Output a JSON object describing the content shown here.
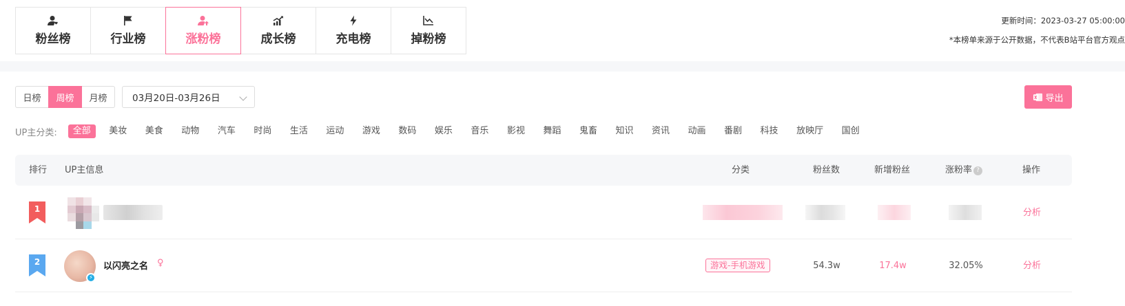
{
  "top_tabs": [
    {
      "label": "粉丝榜",
      "icon": "user-heart-icon"
    },
    {
      "label": "行业榜",
      "icon": "flag-icon"
    },
    {
      "label": "涨粉榜",
      "icon": "user-up-icon",
      "active": true
    },
    {
      "label": "成长榜",
      "icon": "growth-chart-icon"
    },
    {
      "label": "充电榜",
      "icon": "lightning-icon"
    },
    {
      "label": "掉粉榜",
      "icon": "line-chart-down-icon"
    }
  ],
  "header": {
    "update_time": "更新时间：2023-03-27 05:00:00",
    "disclaimer": "*本榜单来源于公开数据，不代表B站平台官方观点"
  },
  "filters": {
    "periods": [
      "日榜",
      "周榜",
      "月榜"
    ],
    "active_period": "周榜",
    "date_range": "03月20日-03月26日",
    "export_label": "导出"
  },
  "categories": {
    "label": "UP主分类:",
    "items": [
      "全部",
      "美妆",
      "美食",
      "动物",
      "汽车",
      "时尚",
      "生活",
      "运动",
      "游戏",
      "数码",
      "娱乐",
      "音乐",
      "影视",
      "舞蹈",
      "鬼畜",
      "知识",
      "资讯",
      "动画",
      "番剧",
      "科技",
      "放映厅",
      "国创"
    ],
    "active": "全部"
  },
  "table": {
    "headers": {
      "rank": "排行",
      "info": "UP主信息",
      "category": "分类",
      "fans": "粉丝数",
      "new_fans": "新增粉丝",
      "growth_rate": "涨粉率",
      "action": "操作"
    },
    "rows": [
      {
        "rank": "1",
        "name": "",
        "category": "",
        "fans": "",
        "new_fans": "",
        "growth_rate": "",
        "action": "分析",
        "blurred": true
      },
      {
        "rank": "2",
        "name": "以闪亮之名",
        "gender": "♀",
        "category": "游戏-手机游戏",
        "fans": "54.3w",
        "new_fans": "17.4w",
        "growth_rate": "32.05%",
        "action": "分析"
      }
    ]
  },
  "colors": {
    "accent": "#fb7299",
    "rank1": "#f25d5d",
    "rank2": "#5aa8f0",
    "verified": "#23ade5"
  }
}
